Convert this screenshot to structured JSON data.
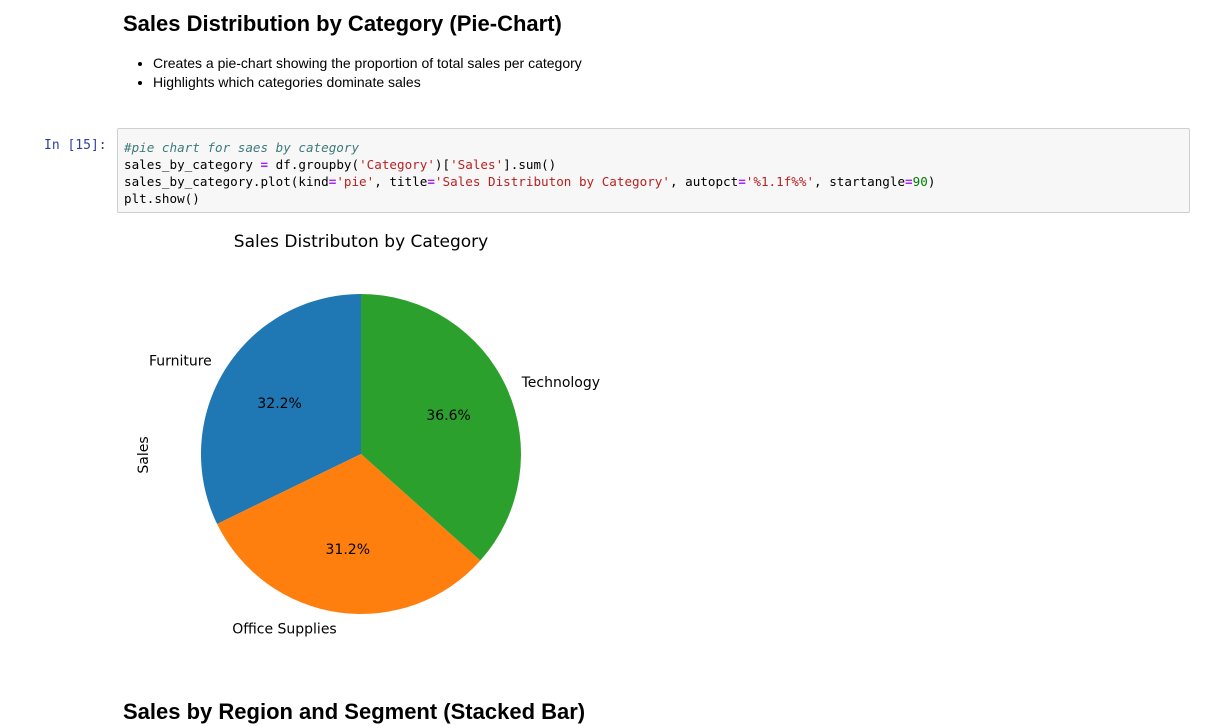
{
  "markdown": {
    "heading": "Sales Distribution by Category (Pie-Chart)",
    "bullets": [
      "Creates a pie-chart showing the proportion of total sales per category",
      "Highlights which categories dominate sales"
    ]
  },
  "code_cell": {
    "prompt": "In [15]:",
    "lines": [
      [
        {
          "t": "#pie chart for saes by category",
          "c": "comment"
        }
      ],
      [
        {
          "t": "sales_by_category ",
          "c": "plain"
        },
        {
          "t": "=",
          "c": "op"
        },
        {
          "t": " df.groupby(",
          "c": "plain"
        },
        {
          "t": "'Category'",
          "c": "str"
        },
        {
          "t": ")[",
          "c": "plain"
        },
        {
          "t": "'Sales'",
          "c": "str"
        },
        {
          "t": "].sum()",
          "c": "plain"
        }
      ],
      [
        {
          "t": "sales_by_category.plot(kind",
          "c": "plain"
        },
        {
          "t": "=",
          "c": "op"
        },
        {
          "t": "'pie'",
          "c": "str"
        },
        {
          "t": ", title",
          "c": "plain"
        },
        {
          "t": "=",
          "c": "op"
        },
        {
          "t": "'Sales Distributon by Category'",
          "c": "str"
        },
        {
          "t": ", autopct",
          "c": "plain"
        },
        {
          "t": "=",
          "c": "op"
        },
        {
          "t": "'%1.1f%%'",
          "c": "str"
        },
        {
          "t": ", startangle",
          "c": "plain"
        },
        {
          "t": "=",
          "c": "op"
        },
        {
          "t": "90",
          "c": "num"
        },
        {
          "t": ")",
          "c": "plain"
        }
      ],
      [
        {
          "t": "plt.show()",
          "c": "plain"
        }
      ]
    ]
  },
  "chart_data": {
    "type": "pie",
    "title": "Sales Distributon by Category",
    "ylabel": "Sales",
    "start_angle_deg": 90,
    "direction": "counterclockwise",
    "slices": [
      {
        "label": "Furniture",
        "value": 32.2,
        "pct_label": "32.2%",
        "color": "#1f77b4"
      },
      {
        "label": "Office Supplies",
        "value": 31.2,
        "pct_label": "31.2%",
        "color": "#ff7f0e"
      },
      {
        "label": "Technology",
        "value": 36.6,
        "pct_label": "36.6%",
        "color": "#2ca02c"
      }
    ]
  },
  "next_markdown": {
    "heading": "Sales by Region and Segment (Stacked Bar)"
  }
}
